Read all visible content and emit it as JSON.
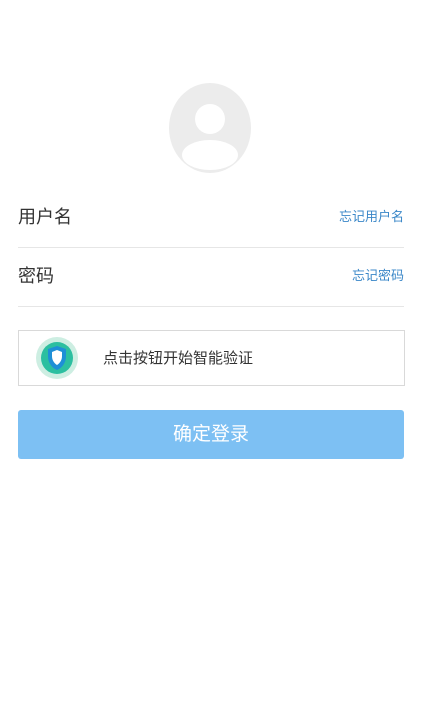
{
  "avatar": {
    "icon": "user-avatar-icon",
    "background_color": "#ececec"
  },
  "form": {
    "username": {
      "label": "用户名",
      "forgot_label": "忘记用户名"
    },
    "password": {
      "label": "密码",
      "forgot_label": "忘记密码"
    }
  },
  "verification": {
    "text": "点击按钮开始智能验证",
    "icon": "shield-icon"
  },
  "login_button": {
    "label": "确定登录",
    "color": "#7dc0f3"
  },
  "colors": {
    "link": "#3a87c8",
    "text": "#333333",
    "divider": "#e6e6e6"
  }
}
